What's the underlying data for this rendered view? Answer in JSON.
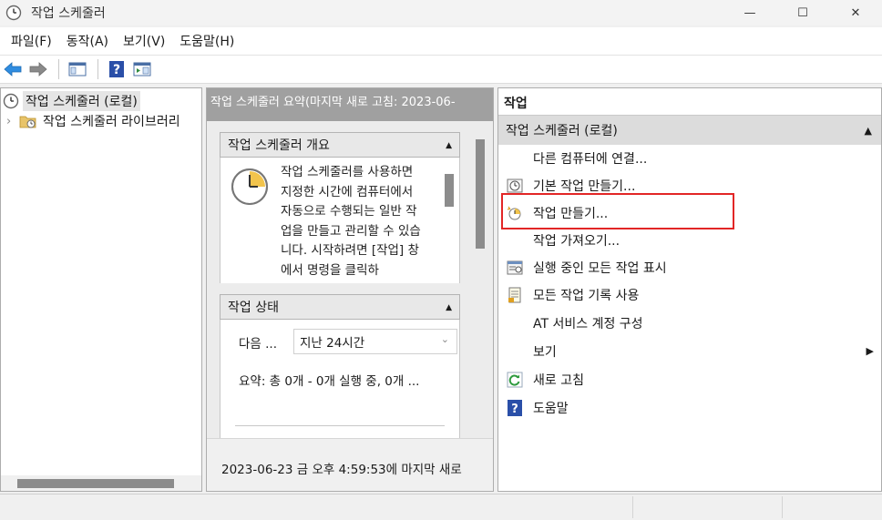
{
  "window": {
    "title": "작업 스케줄러",
    "minimize_glyph": "—",
    "maximize_glyph": "☐",
    "close_glyph": "✕"
  },
  "menu": {
    "items": [
      "파일(F)",
      "동작(A)",
      "보기(V)",
      "도움말(H)"
    ]
  },
  "toolbar": {
    "icons": [
      "back-arrow-icon",
      "forward-arrow-icon",
      "show-hide-console-tree-icon",
      "help-icon",
      "show-hide-action-pane-icon"
    ]
  },
  "tree": {
    "items": [
      {
        "label": "작업 스케줄러 (로컬)",
        "selected": true,
        "icon": "clock-icon"
      },
      {
        "label": "작업 스케줄러 라이브러리",
        "selected": false,
        "icon": "folder-clock-icon",
        "expander": "›"
      }
    ]
  },
  "middle": {
    "header": "작업 스케줄러 요약(마지막 새로 고침: 2023-06-",
    "overview_title": "작업 스케줄러 개요",
    "overview_text": "작업 스케줄러를 사용하면 지정한 시간에 컴퓨터에서 자동으로 수행되는 일반 작업을 만들고 관리할 수 있습니다. 시작하려면 [작업] 창에서 명령을 클릭하",
    "status_title": "작업 상태",
    "status_label": "다음 ...",
    "status_dropdown": "지난 24시간",
    "summary": "요약: 총 0개 - 0개 실행 중, 0개 ...",
    "footer": "2023-06-23 금 오후 4:59:53에 마지막 새로",
    "caret": "▲"
  },
  "actions": {
    "title": "작업",
    "group": "작업 스케줄러 (로컬)",
    "group_caret": "▲",
    "items": [
      {
        "label": "다른 컴퓨터에 연결...",
        "icon": ""
      },
      {
        "label": "기본 작업 만들기...",
        "icon": "basic-task-icon"
      },
      {
        "label": "작업 만들기...",
        "icon": "create-task-icon"
      },
      {
        "label": "작업 가져오기...",
        "icon": ""
      },
      {
        "label": "실행 중인 모든 작업 표시",
        "icon": "running-tasks-icon"
      },
      {
        "label": "모든 작업 기록 사용",
        "icon": "task-history-icon"
      },
      {
        "label": "AT 서비스 계정 구성",
        "icon": ""
      },
      {
        "label": "보기",
        "icon": "",
        "submenu": "▶"
      },
      {
        "label": "새로 고침",
        "icon": "refresh-icon"
      },
      {
        "label": "도움말",
        "icon": "help-icon"
      }
    ],
    "highlighted": "작업 만들기..."
  },
  "colors": {
    "highlight_border": "#e22626",
    "header_gray": "#a0a0a0",
    "group_gray": "#dcdcdc"
  }
}
